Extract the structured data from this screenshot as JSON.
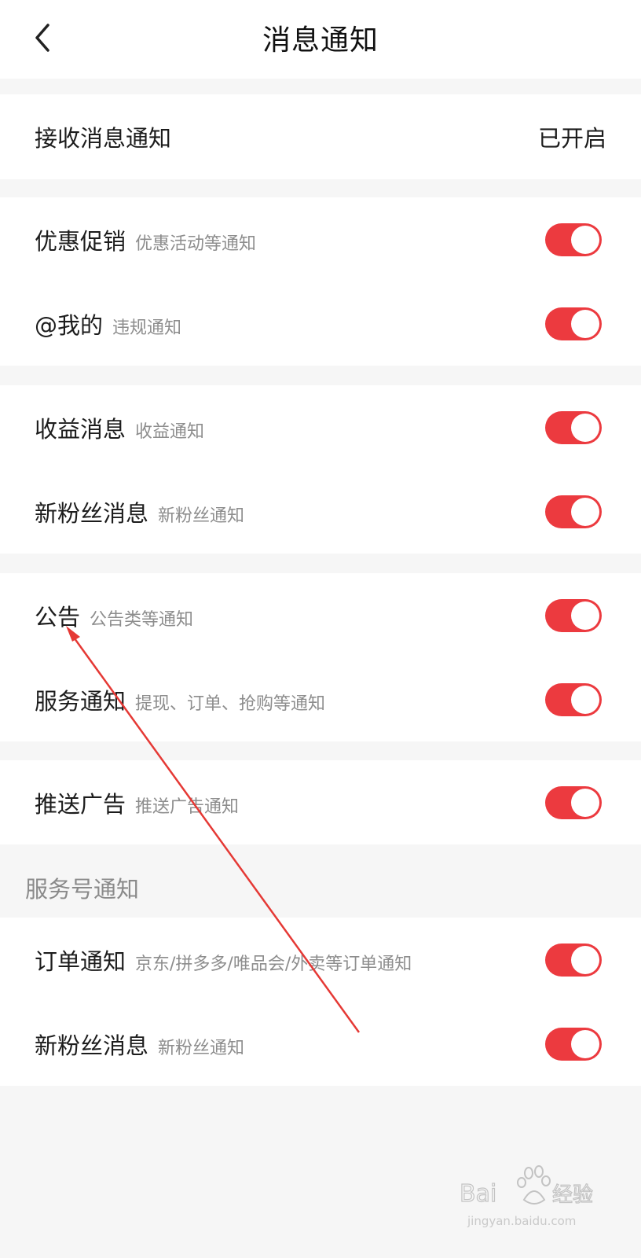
{
  "header": {
    "title": "消息通知",
    "back_icon": "chevron-left-icon"
  },
  "receive": {
    "label": "接收消息通知",
    "status": "已开启"
  },
  "settings": {
    "promo": {
      "label": "优惠促销",
      "sub": "优惠活动等通知",
      "enabled": true
    },
    "mention": {
      "label": "@我的",
      "sub": "违规通知",
      "enabled": true
    },
    "earnings": {
      "label": "收益消息",
      "sub": "收益通知",
      "enabled": true
    },
    "fans": {
      "label": "新粉丝消息",
      "sub": "新粉丝通知",
      "enabled": true
    },
    "announce": {
      "label": "公告",
      "sub": "公告类等通知",
      "enabled": true
    },
    "service": {
      "label": "服务通知",
      "sub": "提现、订单、抢购等通知",
      "enabled": true
    },
    "ads": {
      "label": "推送广告",
      "sub": "推送广告通知",
      "enabled": true
    }
  },
  "service_accounts": {
    "header": "服务号通知",
    "order": {
      "label": "订单通知",
      "sub": "京东/拼多多/唯品会/外卖等订单通知",
      "enabled": true
    },
    "fans": {
      "label": "新粉丝消息",
      "sub": "新粉丝通知",
      "enabled": true
    }
  },
  "colors": {
    "accent": "#ec3a3f",
    "background": "#f6f6f6",
    "annotation_arrow": "#e53935"
  },
  "watermark": {
    "brand": "Baidu经验",
    "url": "jingyan.baidu.com"
  }
}
